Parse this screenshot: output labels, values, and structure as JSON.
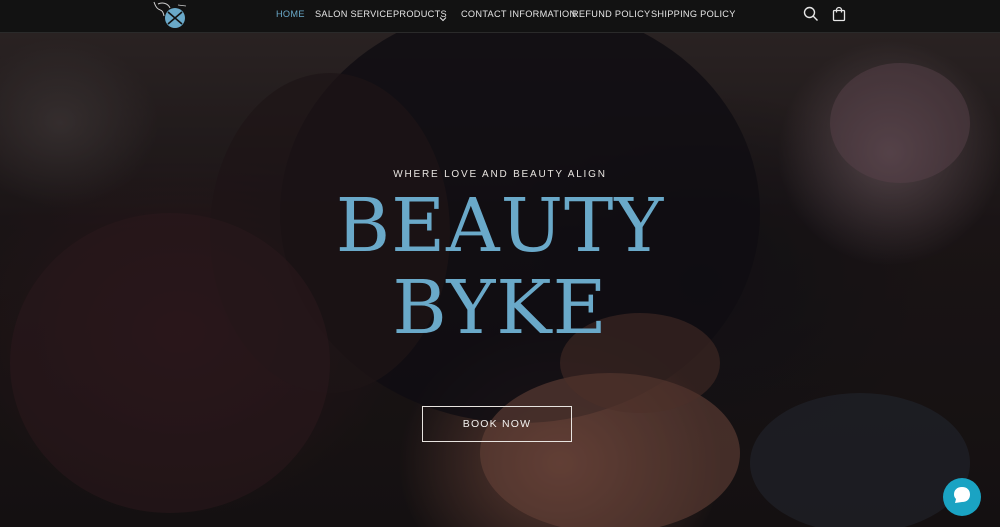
{
  "header": {
    "logo_icon": "beauty-byke-logo",
    "nav": [
      {
        "label": "HOME",
        "active": true
      },
      {
        "label": "SALON SERVICE",
        "active": false
      },
      {
        "label": "PRODUCTS",
        "active": false,
        "has_dropdown": true
      },
      {
        "label": "CONTACT INFORMATION",
        "active": false
      },
      {
        "label": "REFUND POLICY",
        "active": false
      },
      {
        "label": "SHIPPING POLICY",
        "active": false
      }
    ],
    "search_icon": "search-icon",
    "cart_icon": "cart-icon"
  },
  "hero": {
    "subheading": "WHERE LOVE AND BEAUTY ALIGN",
    "title_line1": "BEAUTY",
    "title_line2": "BYKE",
    "button_label": "BOOK NOW"
  },
  "chat": {
    "icon": "chat-bubble-icon"
  },
  "colors": {
    "accent": "#6aa9c9",
    "header_bg": "#121212",
    "chat": "#1aa3c3"
  }
}
